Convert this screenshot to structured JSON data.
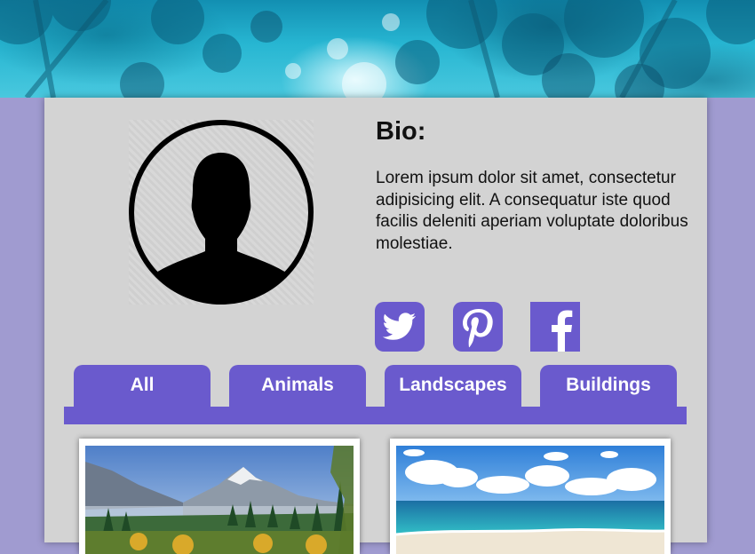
{
  "banner": {
    "alt": "forest canopy banner"
  },
  "profile": {
    "bio_title": "Bio:",
    "bio_text": "Lorem ipsum dolor sit amet, consectetur adipisicing elit. A consequatur iste quod facilis deleniti aperiam voluptate doloribus molestiae."
  },
  "social": [
    {
      "icon": "twitter-icon"
    },
    {
      "icon": "pinterest-icon"
    },
    {
      "icon": "facebook-icon"
    }
  ],
  "tabs": [
    {
      "label": "All"
    },
    {
      "label": "Animals"
    },
    {
      "label": "Landscapes"
    },
    {
      "label": "Buildings"
    }
  ],
  "gallery": [
    {
      "subject": "mountain landscape"
    },
    {
      "subject": "beach seascape"
    }
  ],
  "colors": {
    "accent": "#6a5acd",
    "page_bg": "#a09bd0",
    "card_bg": "#d3d3d3"
  }
}
